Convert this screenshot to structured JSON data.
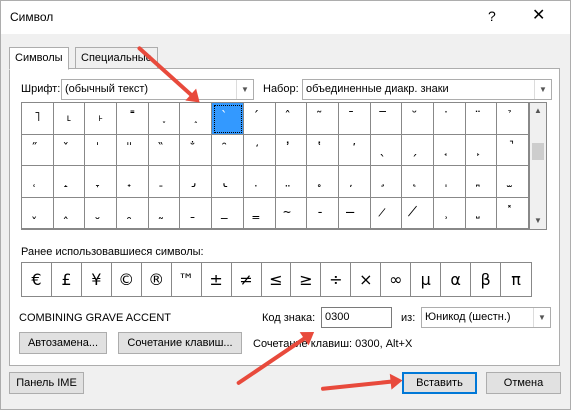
{
  "window": {
    "title": "Символ",
    "help": "?",
    "close": "✕"
  },
  "tabs": [
    {
      "label": "Символы"
    },
    {
      "label": "Специальные знаки"
    }
  ],
  "font": {
    "label": "Шрифт:",
    "value": "(обычный текст)"
  },
  "subset": {
    "label": "Набор:",
    "value": "объединенные диакр. знаки"
  },
  "grid": {
    "rows": [
      [
        "˥",
        "˪",
        "˫",
        "˭",
        "˯",
        "˰",
        "̀",
        "́",
        "̂",
        "̃",
        "̄",
        "̅",
        "̆",
        "̇",
        "̈",
        "̉"
      ],
      [
        "̋",
        "̌",
        "̍",
        "̎",
        "̏",
        "̐",
        "̑",
        "̒",
        "̓",
        "̔",
        "̕",
        "̖",
        "̗",
        "̘",
        "̙",
        "̚"
      ],
      [
        "̜",
        "̝",
        "̞",
        "̟",
        "̠",
        "̡",
        "̢",
        "̣",
        "̤",
        "̥",
        "̦",
        "̧",
        "̨",
        "̩",
        "̪",
        "̫"
      ],
      [
        "̬",
        "̭",
        "̮",
        "̯",
        "̰",
        "̱",
        "̲",
        "̳",
        "̴",
        "̵",
        "̶",
        "̷",
        "̸",
        "̹",
        "̺",
        "̽"
      ]
    ],
    "selected_index": 6
  },
  "recent": {
    "label": "Ранее использовавшиеся символы:",
    "symbols": [
      "€",
      "£",
      "¥",
      "©",
      "®",
      "™",
      "±",
      "≠",
      "≤",
      "≥",
      "÷",
      "×",
      "∞",
      "µ",
      "α",
      "β",
      "π"
    ]
  },
  "char_name": "COMBINING GRAVE ACCENT",
  "code": {
    "label": "Код знака:",
    "value": "0300"
  },
  "from": {
    "label": "из:",
    "value": "Юникод (шестн.)"
  },
  "buttons": {
    "autocorrect": "Автозамена...",
    "shortcut_key": "Сочетание клавиш...",
    "ime_pad": "Панель IME",
    "insert": "Вставить",
    "cancel": "Отмена"
  },
  "shortcut_text": "Сочетание клавиш: 0300, Alt+X",
  "colors": {
    "selection": "#3399ff",
    "arrows": "#e84a3c",
    "default_button_border": "#0078d7"
  }
}
